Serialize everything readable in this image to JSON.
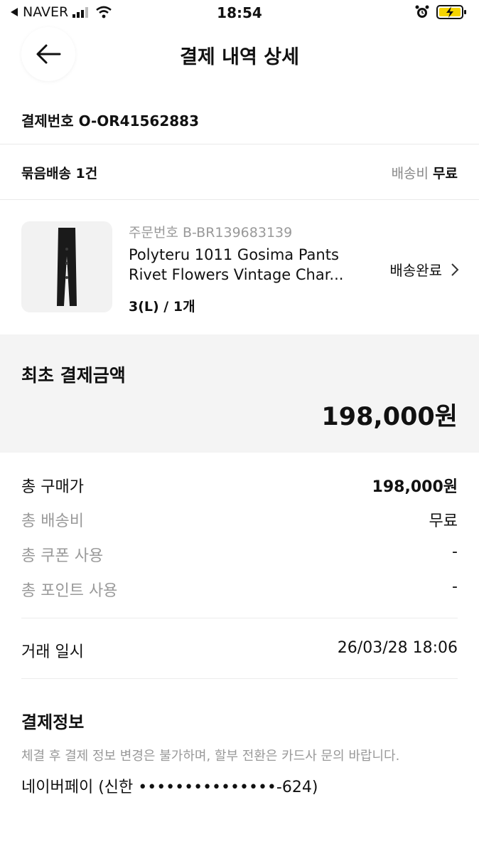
{
  "status": {
    "carrier": "NAVER",
    "time": "18:54"
  },
  "header": {
    "title": "결제 내역 상세"
  },
  "payment": {
    "number_label": "결제번호",
    "number": "O-OR41562883"
  },
  "bundle": {
    "label": "묶음배송 1건",
    "shipping_label": "배송비",
    "shipping_value": "무료"
  },
  "product": {
    "order_label": "주문번호",
    "order_number": "B-BR139683139",
    "name_line1": "Polyteru 1011 Gosima Pants",
    "name_line2": "Rivet Flowers Vintage Char...",
    "option": "3(L) / 1개",
    "status": "배송완료"
  },
  "summary": {
    "label": "최초 결제금액",
    "amount": "198,000원"
  },
  "details": [
    {
      "label": "총 구매가",
      "value": "198,000원"
    },
    {
      "label": "총 배송비",
      "value": "무료"
    },
    {
      "label": "총 쿠폰 사용",
      "value": "-"
    },
    {
      "label": "총 포인트 사용",
      "value": "-"
    }
  ],
  "transaction": {
    "label": "거래 일시",
    "value": "26/03/28 18:06"
  },
  "payment_info": {
    "title": "결제정보",
    "notice": "체결 후 결제 정보 변경은 불가하며, 할부 전환은 카드사 문의 바랍니다.",
    "method": "네이버페이 (신한 •••••••••••••••-624)"
  },
  "colors": {
    "summary_bg": "#f4f4f4",
    "muted_text": "#9a9a9a",
    "battery_charging": "#f5d400"
  }
}
